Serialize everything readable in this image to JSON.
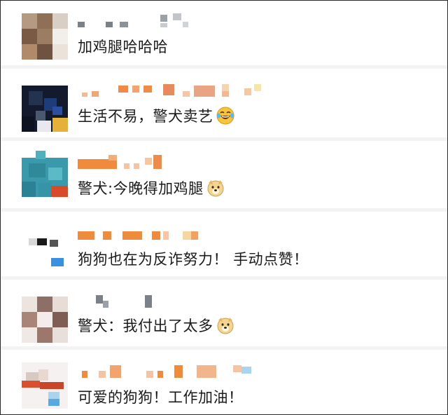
{
  "comments": [
    {
      "text": "加鸡腿哈哈哈",
      "emoji": ""
    },
    {
      "text": "生活不易，警犬卖艺",
      "emoji": "laughing-tears-emoji"
    },
    {
      "text": "警犬:今晚得加鸡腿",
      "emoji": "doge-emoji"
    },
    {
      "text": "狗狗也在为反诈努力！ 手动点赞！",
      "emoji": ""
    },
    {
      "text": "警犬：我付出了太多",
      "emoji": "doge-emoji"
    },
    {
      "text": "可爱的狗狗！工作加油！",
      "emoji": ""
    }
  ]
}
